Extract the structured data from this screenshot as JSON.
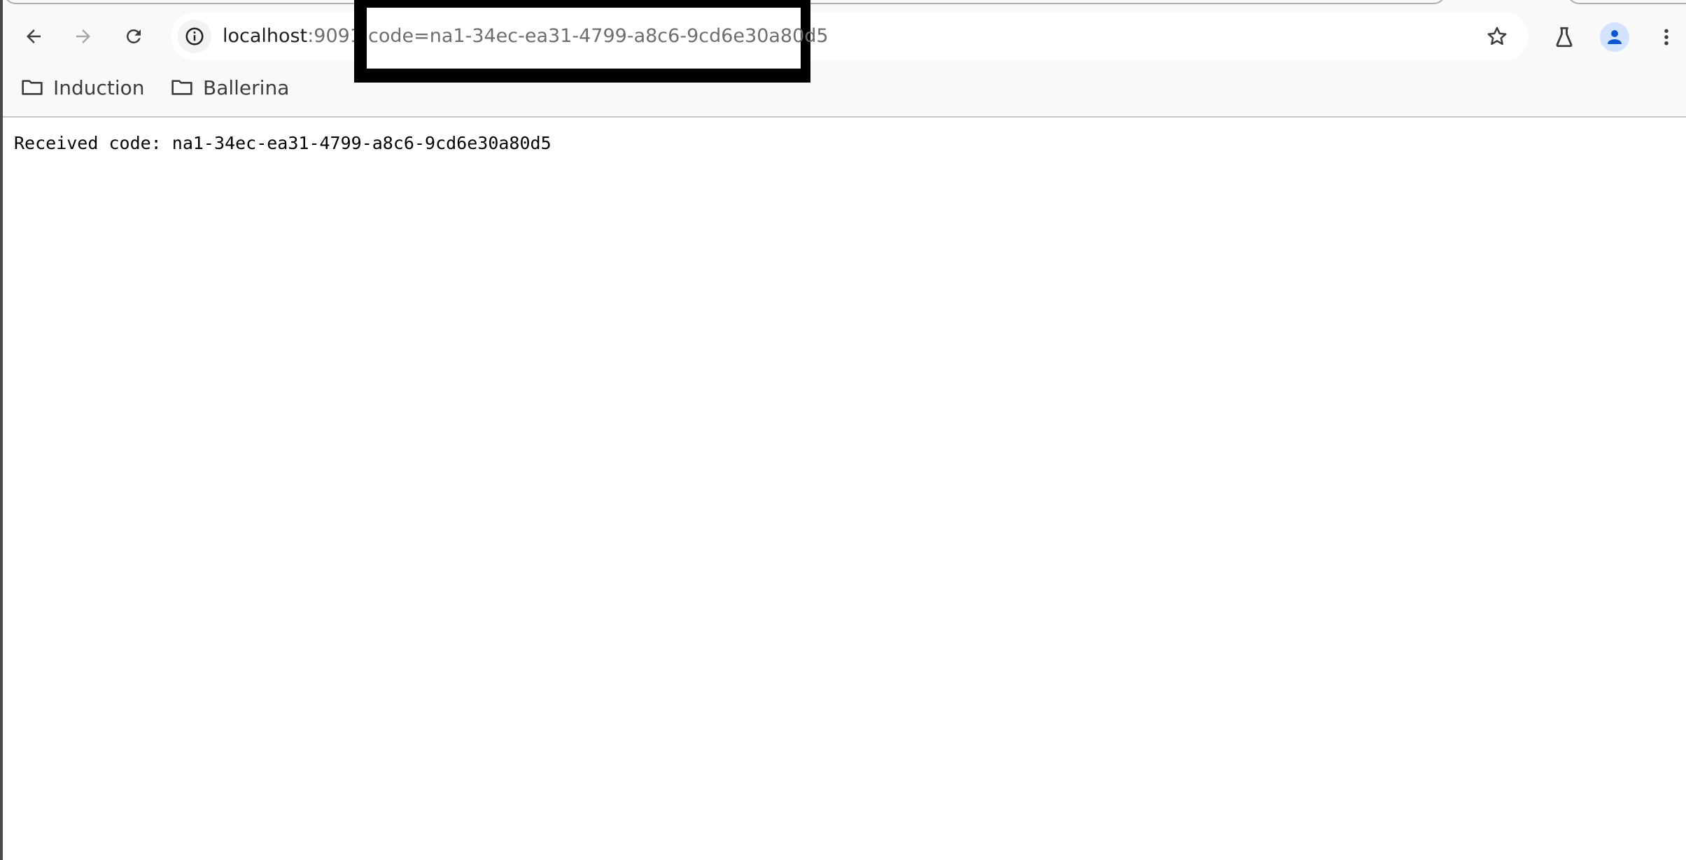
{
  "browser": {
    "address_bar": {
      "host": "localhost",
      "port_and_path_visible": ":9091/",
      "query_visible": "code=na1-34ec-ea31-4799-a8c6-9cd6e30a80d5",
      "redacted": true
    },
    "nav": {
      "back_icon": "arrow-left",
      "forward_icon": "arrow-right",
      "reload_icon": "reload",
      "site_info_icon": "info-circle",
      "bookmark_star_icon": "star-outline",
      "labs_icon": "flask",
      "profile_icon": "person",
      "menu_icon": "vertical-dots"
    },
    "colors": {
      "chrome_bg": "#f9f9fa",
      "omnibox_bg": "#ffffff",
      "profile_accent": "#0b57d0",
      "profile_bg": "#d3e3fd",
      "url_muted": "#6e6e6e"
    },
    "bookmarks": [
      {
        "label": "Induction",
        "icon": "folder"
      },
      {
        "label": "Ballerina",
        "icon": "folder"
      }
    ]
  },
  "page": {
    "message_label": "Received code:",
    "code_value": "na1-34ec-ea31-4799-a8c6-9cd6e30a80d5"
  }
}
